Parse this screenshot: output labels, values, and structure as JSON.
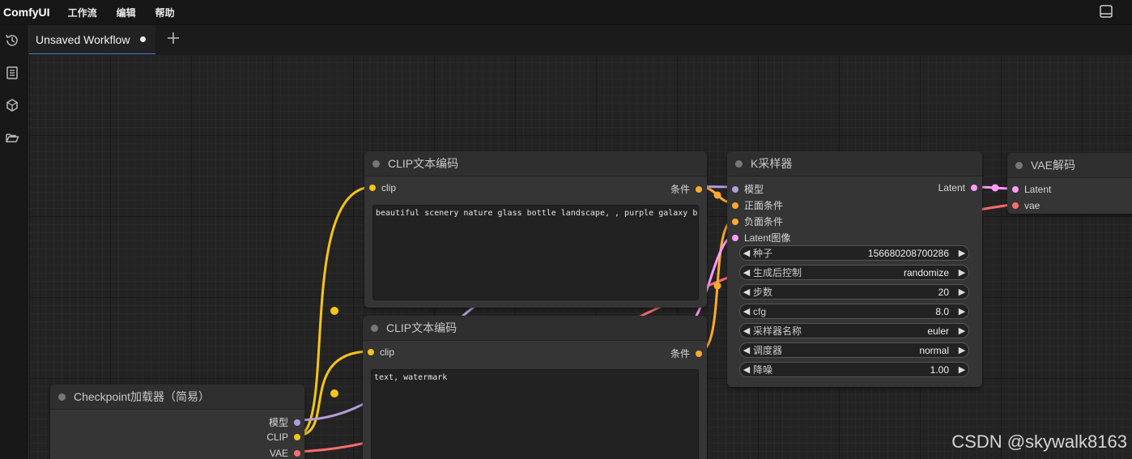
{
  "app": {
    "brand": "ComfyUI"
  },
  "menu": [
    "工作流",
    "编辑",
    "帮助"
  ],
  "tab": {
    "title": "Unsaved Workflow"
  },
  "nodes": {
    "clip1": {
      "title": "CLIP文本编码",
      "input": "clip",
      "output": "条件",
      "text": "beautiful scenery nature glass bottle landscape, , purple galaxy bottle,"
    },
    "clip2": {
      "title": "CLIP文本编码",
      "input": "clip",
      "output": "条件",
      "text": "text, watermark"
    },
    "ksampler": {
      "title": "K采样器",
      "inputs": [
        "模型",
        "正面条件",
        "负面条件",
        "Latent图像"
      ],
      "output": "Latent",
      "widgets": [
        {
          "name": "种子",
          "value": "156680208700286"
        },
        {
          "name": "生成后控制",
          "value": "randomize"
        },
        {
          "name": "步数",
          "value": "20"
        },
        {
          "name": "cfg",
          "value": "8.0"
        },
        {
          "name": "采样器名称",
          "value": "euler"
        },
        {
          "name": "调度器",
          "value": "normal"
        },
        {
          "name": "降噪",
          "value": "1.00"
        }
      ]
    },
    "vae": {
      "title": "VAE解码",
      "inputs": [
        "Latent",
        "vae"
      ]
    },
    "checkpoint": {
      "title": "Checkpoint加载器（简易）",
      "outputs": [
        "模型",
        "CLIP",
        "VAE"
      ]
    }
  },
  "colors": {
    "clip": "#f5c518",
    "model": "#b39ddb",
    "conditioning": "#ffa931",
    "latent": "#ff9cf9",
    "vae": "#ff6e6e"
  },
  "watermark": "CSDN @skywalk8163"
}
